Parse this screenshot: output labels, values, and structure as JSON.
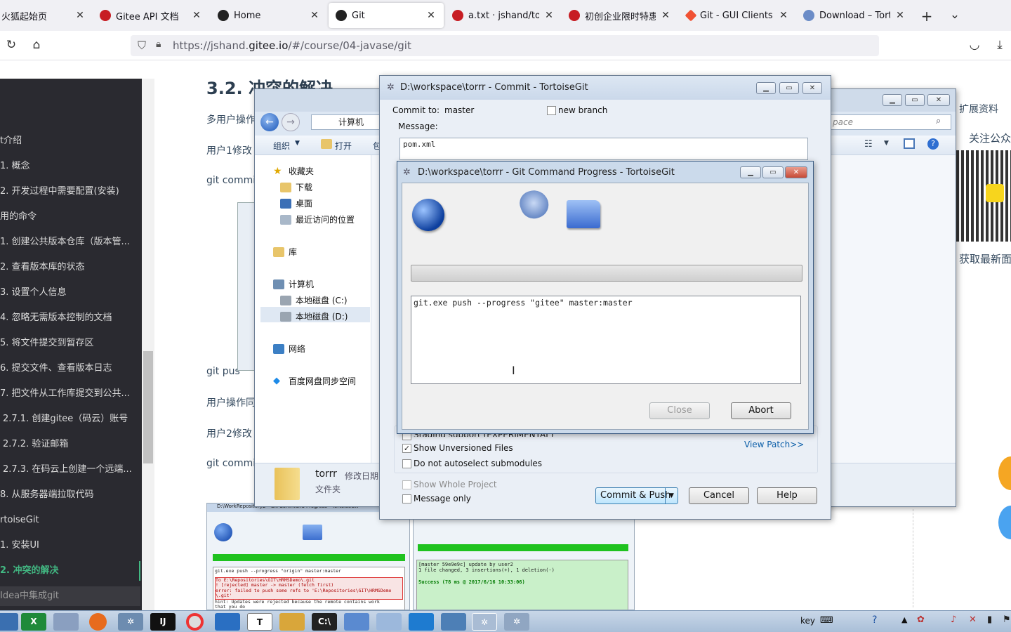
{
  "browser": {
    "tabs": [
      {
        "label": "火狐起始页",
        "icon": "firefox-icon",
        "color": "#ff9500"
      },
      {
        "label": "Gitee API 文档",
        "icon": "gitee-icon",
        "color": "#c71d23"
      },
      {
        "label": "Home",
        "icon": "github-icon",
        "color": "#222222"
      },
      {
        "label": "Git",
        "icon": "github-icon",
        "color": "#222222"
      },
      {
        "label": "a.txt · jshand/torrr",
        "icon": "gitee-icon",
        "color": "#c71d23"
      },
      {
        "label": "初创企业限时特惠，",
        "icon": "gitee-icon",
        "color": "#c71d23"
      },
      {
        "label": "Git - GUI Clients",
        "icon": "git-icon",
        "color": "#f05133"
      },
      {
        "label": "Download – Tortoi",
        "icon": "tortoise-icon",
        "color": "#6b8cc7"
      }
    ],
    "url_prefix": "https://jshand.",
    "url_domain": "gitee.io",
    "url_suffix": "/#/course/04-javase/git"
  },
  "sidebar": {
    "items": [
      {
        "label": "t介绍",
        "indent": 0
      },
      {
        "label": "1. 概念",
        "indent": 0
      },
      {
        "label": "2. 开发过程中需要配置(安装)",
        "indent": 0
      },
      {
        "label": "用的命令",
        "indent": 0
      },
      {
        "label": "1. 创建公共版本仓库（版本管...",
        "indent": 0
      },
      {
        "label": "2. 查看版本库的状态",
        "indent": 0
      },
      {
        "label": "3. 设置个人信息",
        "indent": 0
      },
      {
        "label": "4. 忽略无需版本控制的文档",
        "indent": 0
      },
      {
        "label": "5. 将文件提交到暂存区",
        "indent": 0
      },
      {
        "label": "6. 提交文件、查看版本日志",
        "indent": 0
      },
      {
        "label": "7. 把文件从工作库提交到公共...",
        "indent": 0
      },
      {
        "label": "2.7.1. 创建gitee（码云）账号",
        "indent": 1
      },
      {
        "label": "2.7.2. 验证邮箱",
        "indent": 1
      },
      {
        "label": "2.7.3. 在码云上创建一个远端...",
        "indent": 1
      },
      {
        "label": "8. 从服务器端拉取代码",
        "indent": 0
      },
      {
        "label": "rtoiseGit",
        "indent": 0
      },
      {
        "label": "1. 安装UI",
        "indent": 0
      },
      {
        "label": "2. 冲突的解决",
        "indent": 0,
        "active": true
      },
      {
        "label": "Idea中集成git",
        "indent": 0
      }
    ]
  },
  "content": {
    "heading": "3.2. 冲突的解决",
    "paragraphs": [
      "多用户操作",
      "用户1修改",
      "git commit",
      "git pus",
      "用户操作同",
      "用户2修改",
      "git commit"
    ],
    "right_title": "扩展资料",
    "follow": "关注公众",
    "get_latest": "获取最新面"
  },
  "explorer": {
    "breadcrumb": "计算机",
    "search_placeholder": "pace",
    "toolbar": {
      "organize": "组织",
      "open": "打开",
      "include": "包"
    },
    "tree": [
      {
        "label": "收藏夹",
        "icon": "star-icon"
      },
      {
        "label": "下载",
        "icon": "download-folder-icon"
      },
      {
        "label": "桌面",
        "icon": "desktop-icon"
      },
      {
        "label": "最近访问的位置",
        "icon": "recent-icon"
      },
      {
        "label": "库",
        "icon": "library-icon"
      },
      {
        "label": "计算机",
        "icon": "computer-icon"
      },
      {
        "label": "本地磁盘 (C:)",
        "icon": "disk-icon"
      },
      {
        "label": "本地磁盘 (D:)",
        "icon": "disk-icon"
      },
      {
        "label": "网络",
        "icon": "network-icon"
      },
      {
        "label": "百度网盘同步空间",
        "icon": "baidu-icon"
      }
    ],
    "file_name": "torrr",
    "file_meta": "修改日期",
    "file_type": "文件夹"
  },
  "commit": {
    "title": "D:\\workspace\\torrr - Commit - TortoiseGit",
    "commit_to_label": "Commit to:",
    "branch": "master",
    "new_branch": "new branch",
    "message_label": "Message:",
    "message": "pom.xml",
    "staging": "Staging support (EXPERIMENTAL)",
    "show_unversioned": "Show Unversioned Files",
    "no_autoselect": "Do not autoselect submodules",
    "view_patch": "View Patch>>",
    "show_whole_project": "Show Whole Project",
    "message_only": "Message only",
    "commit_push": "Commit & Push",
    "cancel": "Cancel",
    "help": "Help"
  },
  "progress": {
    "title": "D:\\workspace\\torrr - Git Command Progress - TortoiseGit",
    "command": "git.exe push --progress \"gitee\" master:master",
    "close": "Close",
    "abort": "Abort"
  },
  "thumbnail": {
    "title": "D:\\WorkRepository2 - Git Command Progress - TortoiseGit",
    "left_cmd": "git.exe push --progress \"origin\" master:master",
    "left_lines": [
      "To E:\\Repositories\\GIT\\HRMSDemo\\.git",
      "! [rejected]        master -> master (fetch first)",
      "error: failed to push some refs to 'E:\\Repositories\\GIT\\HRMSDemo",
      "\\.git'",
      "hint: Updates were rejected because the remote contains work",
      "that you do"
    ],
    "right_lines": [
      "[master 59e9e9c] update by user2",
      " 1 file changed, 3 insertions(+), 1 deletion(-)"
    ],
    "right_success": "Success (78 ms @ 2017/6/16 10:33:06)"
  },
  "taskbar": {
    "tray_text": "key",
    "apps": [
      "start",
      "excel",
      "paint",
      "firefox",
      "settings",
      "idea",
      "chrome",
      "remote",
      "typora",
      "ftp",
      "cmd",
      "tortoise",
      "notepad",
      "tool",
      "vm",
      "git",
      "git2"
    ]
  }
}
